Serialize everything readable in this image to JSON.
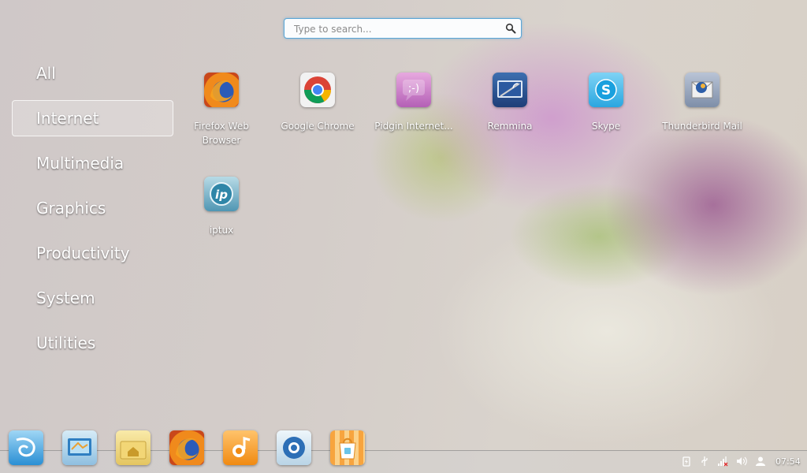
{
  "search": {
    "placeholder": "Type to search..."
  },
  "categories": [
    {
      "label": "All",
      "selected": false
    },
    {
      "label": "Internet",
      "selected": true
    },
    {
      "label": "Multimedia",
      "selected": false
    },
    {
      "label": "Graphics",
      "selected": false
    },
    {
      "label": "Productivity",
      "selected": false
    },
    {
      "label": "System",
      "selected": false
    },
    {
      "label": "Utilities",
      "selected": false
    }
  ],
  "apps": [
    {
      "label": "Firefox Web Browser",
      "icon": "firefox-icon"
    },
    {
      "label": "Google Chrome",
      "icon": "chrome-icon"
    },
    {
      "label": "Pidgin Internet...",
      "icon": "pidgin-icon"
    },
    {
      "label": "Remmina",
      "icon": "remmina-icon"
    },
    {
      "label": "Skype",
      "icon": "skype-icon"
    },
    {
      "label": "Thunderbird Mail",
      "icon": "thunderbird-icon"
    },
    {
      "label": "iptux",
      "icon": "iptux-icon"
    }
  ],
  "dock": {
    "items": [
      {
        "name": "launcher",
        "icon": "deepin-launcher-icon"
      },
      {
        "name": "control-center",
        "icon": "control-center-icon"
      },
      {
        "name": "file-manager",
        "icon": "home-folder-icon"
      },
      {
        "name": "firefox",
        "icon": "firefox-icon"
      },
      {
        "name": "music-player",
        "icon": "music-icon"
      },
      {
        "name": "software-center",
        "icon": "store-icon"
      },
      {
        "name": "store",
        "icon": "shopping-bag-icon"
      }
    ],
    "tray": [
      "power-icon",
      "usb-icon",
      "network-icon",
      "volume-icon",
      "user-icon"
    ],
    "clock": "07:54"
  },
  "colors": {
    "search_border": "#5aa6d6",
    "text": "#ffffff"
  }
}
